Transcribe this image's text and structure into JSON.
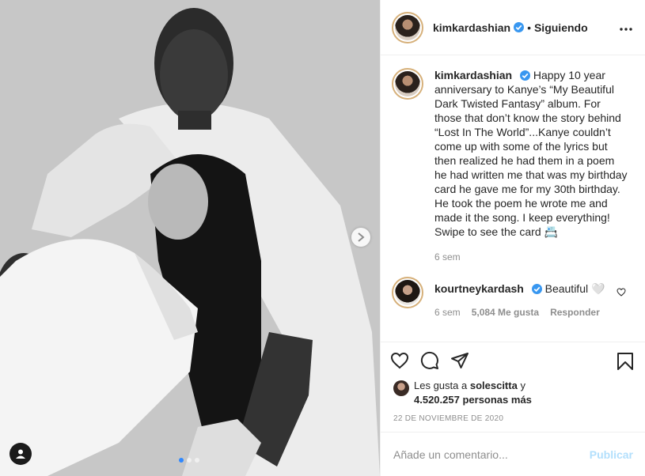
{
  "post": {
    "author": "kimkardashian",
    "follow_status": "Siguiendo",
    "separator": "•",
    "caption": "Happy 10 year anniversary to Kanye’s “My Beautiful Dark Twisted Fantasy” album. For those that don’t know the story behind “Lost In The World”...Kanye couldn’t come up with some of the lyrics but then realized he had them in a poem he had written me that was my birthday card he gave me for my 30th birthday. He took the poem he wrote me and made it the song. I keep everything! Swipe to see the card 📇",
    "caption_time": "6 sem",
    "carousel": {
      "slides": 3,
      "active_index": 0
    }
  },
  "comments": [
    {
      "user": "kourtneykardash",
      "text": "Beautiful 🤍",
      "time": "6 sem",
      "likes": "5,084 Me gusta",
      "reply_label": "Responder"
    }
  ],
  "likes": {
    "prefix": "Les gusta a",
    "liker": "solescitta",
    "conjunction": "y",
    "others_count": "4.520.257",
    "others_label": "personas más"
  },
  "date": "22 DE NOVIEMBRE DE 2020",
  "composer": {
    "placeholder": "Añade un comentario...",
    "publish_label": "Publicar"
  },
  "icons": {
    "verified": "verified-badge-icon",
    "more": "more-options-icon",
    "like": "heart-icon",
    "comment": "comment-bubble-icon",
    "share": "paper-plane-icon",
    "save": "bookmark-icon",
    "next": "chevron-right-icon",
    "tags": "user-tag-icon"
  },
  "colors": {
    "verified": "#3897f0",
    "publish_disabled": "#b2dffc",
    "muted": "#8e8e8e",
    "carousel_active": "#2f88ff"
  }
}
